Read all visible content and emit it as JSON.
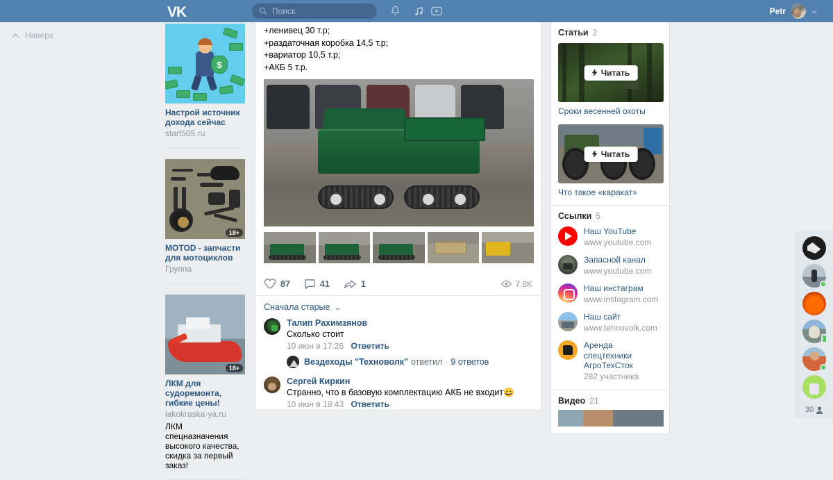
{
  "header": {
    "logo_icon": "vk-logo-icon",
    "search": {
      "placeholder": "Поиск",
      "value": "",
      "icon": "search-icon"
    },
    "icons": [
      {
        "name": "notifications-bell-icon",
        "glyph": "bell"
      },
      {
        "name": "music-note-icon",
        "glyph": "music"
      },
      {
        "name": "video-play-icon",
        "glyph": "video"
      }
    ],
    "user": {
      "name": "Petr",
      "avatar_icon": "user-avatar",
      "caret_icon": "chevron-down-icon"
    },
    "bg_color": "#5281b0"
  },
  "left_rail": {
    "to_top_label": "Наверх",
    "to_top_icon": "chevron-up-icon"
  },
  "ads": [
    {
      "title": "Настрой источник дохода сейчас",
      "domain": "start505.ru",
      "description": "",
      "age_badge": "",
      "image_alt": "businessman-with-money-bag"
    },
    {
      "title": "MOTOD - запчасти для мотоциклов",
      "domain": "Группа",
      "description": "",
      "age_badge": "18+",
      "image_alt": "motorcycle-parts-flatlay"
    },
    {
      "title": "ЛКМ для судоремонта, гибкие цены!",
      "domain": "lakokraska-ya.ru",
      "description": "ЛКМ спецназначения высокого качества, скидка за первый заказ!",
      "age_badge": "18+",
      "image_alt": "red-ship-in-dock"
    }
  ],
  "post": {
    "text_lines": [
      "+ленивец 30 т.р;",
      "+раздаточная коробка 14,5 т.р;",
      "+вариатор 10,5 т.р;",
      "+АКБ 5 т.р."
    ],
    "main_photo_alt": "green-tracked-all-terrain-vehicle",
    "thumbnails": [
      "green-atv-front-view",
      "green-atv-rear-view",
      "green-atv-side-view",
      "crated-vehicle-on-trailer",
      "yellow-forklift-loading"
    ],
    "actions": {
      "like_icon": "heart-icon",
      "likes": "87",
      "comment_icon": "comment-bubble-icon",
      "comments": "41",
      "share_icon": "share-arrow-icon",
      "shares": "1",
      "views_icon": "eye-icon",
      "views": "7.8K"
    }
  },
  "comments_section": {
    "sort_label": "Сначала старые",
    "sort_caret_icon": "chevron-down-icon",
    "items": [
      {
        "author": "Талип Рахимзянов",
        "text": "Сколько стоит",
        "time": "10 июн в 17:26",
        "reply_label": "Ответить",
        "avatar_alt": "talip-avatar",
        "thread": {
          "author": "Вездеходы \"Техноволк\"",
          "action_text": "ответил",
          "separator": "·",
          "replies_count": "9 ответов",
          "avatar_alt": "tehnovolk-group-avatar"
        }
      },
      {
        "author": "Сергей Киркин",
        "text": "Странно, что в базовую комплектацию АКБ не входит😄",
        "time": "10 июн в 18:43",
        "reply_label": "Ответить",
        "avatar_alt": "sergey-avatar"
      }
    ]
  },
  "right_sidebar": {
    "articles": {
      "title": "Статьи",
      "count": "2",
      "read_button_label": "Читать",
      "read_button_icon": "lightning-bolt-icon",
      "items": [
        {
          "title": "Сроки весенней охоты",
          "image_alt": "hunter-in-forest"
        },
        {
          "title": "Что такое «каракат»",
          "image_alt": "atv-big-tyres"
        }
      ]
    },
    "links": {
      "title": "Ссылки",
      "count": "5",
      "items": [
        {
          "name": "Наш YouTube",
          "sub": "www.youtube.com",
          "icon": "youtube-icon"
        },
        {
          "name": "Запасной канал",
          "sub": "www.youtube.com",
          "icon": "spare-channel-avatar"
        },
        {
          "name": "Наш инстаграм",
          "sub": "www.instagram.com",
          "icon": "instagram-icon"
        },
        {
          "name": "Наш сайт",
          "sub": "www.tehnovolk.com",
          "icon": "website-avatar"
        },
        {
          "name": "Аренда спецтехники АгроТехСток",
          "sub": "282 участника",
          "icon": "agro-group-avatar"
        }
      ]
    },
    "video": {
      "title": "Видео",
      "count": "21"
    }
  },
  "friends_bar": {
    "count": "30",
    "count_icon": "person-icon",
    "friends": [
      {
        "alt": "hammer-pick-logo-avatar",
        "status": ""
      },
      {
        "alt": "man-on-shore-avatar",
        "status": "online"
      },
      {
        "alt": "orange-abstract-avatar",
        "status": ""
      },
      {
        "alt": "bearded-man-cap-avatar",
        "status": "mobile"
      },
      {
        "alt": "man-orange-shirt-avatar",
        "status": "online"
      },
      {
        "alt": "green-background-avatar",
        "status": ""
      }
    ]
  }
}
